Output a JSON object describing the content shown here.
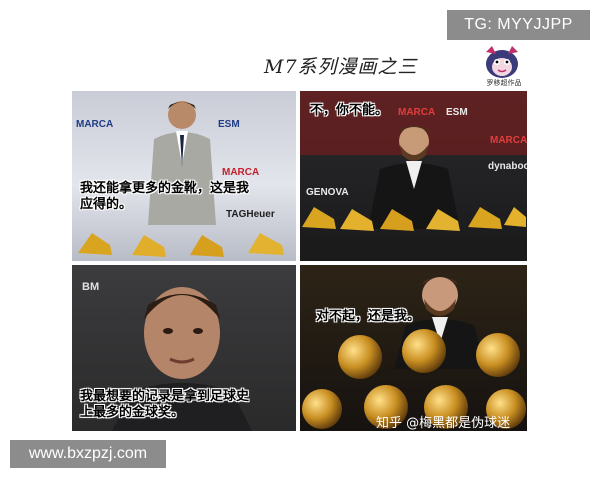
{
  "badges": {
    "top_right": "TG: MYYJJPP",
    "bottom_left": "www.bxzpzj.com"
  },
  "title": "M7系列漫画之三",
  "logo": {
    "caption": "罗移超作品",
    "icon": "mascot-icon"
  },
  "panels": [
    {
      "caption_lines": [
        "我还能拿更多的金靴，这是我",
        "应得的。"
      ],
      "sponsors": [
        "MARCA",
        "ESM",
        "MARCA",
        "TAGHeuer"
      ]
    },
    {
      "caption_lines": [
        "不，你不能。"
      ],
      "sponsors": [
        "MARCA",
        "ESM",
        "MARCA",
        "GENOVA",
        "dynabook"
      ]
    },
    {
      "caption_lines": [
        "我最想要的记录是拿到足球史",
        "上最多的金球奖。"
      ],
      "sponsors": [
        "BM"
      ]
    },
    {
      "caption_lines": [
        "对不起，还是我。"
      ],
      "sponsors": []
    }
  ],
  "attribution": "知乎 @梅黑都是伪球迷"
}
